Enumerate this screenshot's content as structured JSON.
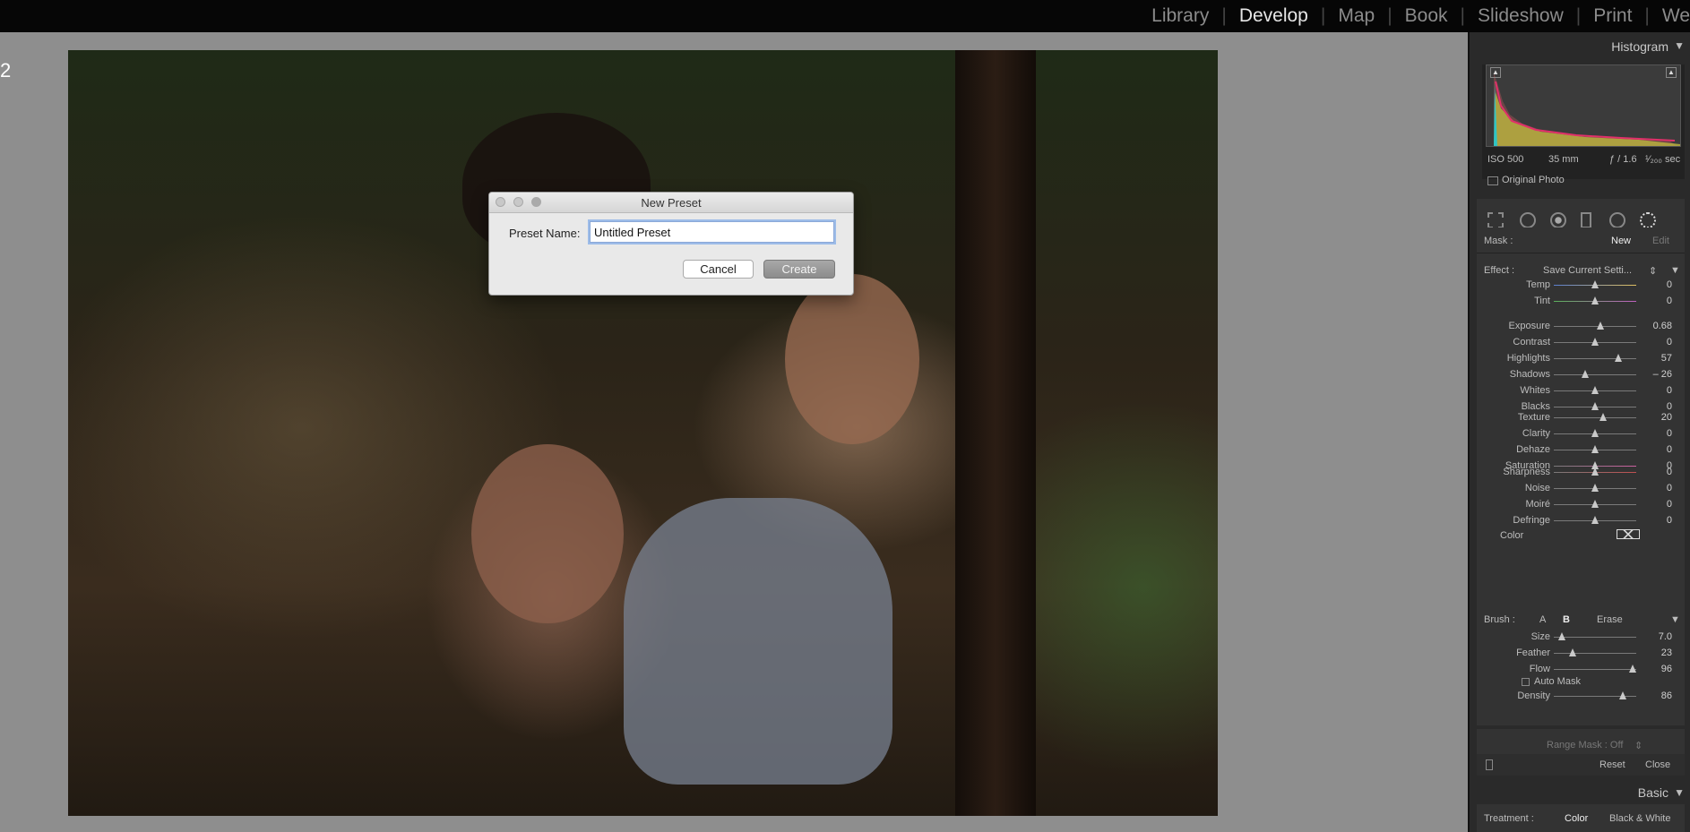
{
  "topbar": {
    "modules": [
      "Library",
      "Develop",
      "Map",
      "Book",
      "Slideshow",
      "Print",
      "We"
    ],
    "active": "Develop"
  },
  "left_fragment": "2",
  "histogram": {
    "title": "Histogram",
    "iso": "ISO 500",
    "focal": "35 mm",
    "aperture": "ƒ / 1.6",
    "shutter": "¹⁄₂₀₀ sec",
    "original_photo": "Original Photo"
  },
  "mask": {
    "label": "Mask :",
    "new": "New",
    "edit": "Edit"
  },
  "effect": {
    "label": "Effect :",
    "value": "Save Current Setti..."
  },
  "sliders_group1": [
    {
      "name": "Temp",
      "value": "0",
      "pos": 0.5
    },
    {
      "name": "Tint",
      "value": "0",
      "pos": 0.5
    }
  ],
  "sliders_group2": [
    {
      "name": "Exposure",
      "value": "0.68",
      "pos": 0.57
    },
    {
      "name": "Contrast",
      "value": "0",
      "pos": 0.5
    },
    {
      "name": "Highlights",
      "value": "57",
      "pos": 0.78
    },
    {
      "name": "Shadows",
      "value": "– 26",
      "pos": 0.38
    },
    {
      "name": "Whites",
      "value": "0",
      "pos": 0.5
    },
    {
      "name": "Blacks",
      "value": "0",
      "pos": 0.5
    }
  ],
  "sliders_group3": [
    {
      "name": "Texture",
      "value": "20",
      "pos": 0.6
    },
    {
      "name": "Clarity",
      "value": "0",
      "pos": 0.5
    },
    {
      "name": "Dehaze",
      "value": "0",
      "pos": 0.5
    },
    {
      "name": "Saturation",
      "value": "0",
      "pos": 0.5
    }
  ],
  "sliders_group4": [
    {
      "name": "Sharpness",
      "value": "0",
      "pos": 0.5
    },
    {
      "name": "Noise",
      "value": "0",
      "pos": 0.5
    },
    {
      "name": "Moiré",
      "value": "0",
      "pos": 0.5
    },
    {
      "name": "Defringe",
      "value": "0",
      "pos": 0.5
    }
  ],
  "color_label": "Color",
  "brush": {
    "label": "Brush :",
    "a": "A",
    "b": "B",
    "erase": "Erase"
  },
  "brush_sliders": [
    {
      "name": "Size",
      "value": "7.0",
      "pos": 0.1
    },
    {
      "name": "Feather",
      "value": "23",
      "pos": 0.23
    },
    {
      "name": "Flow",
      "value": "96",
      "pos": 0.96
    }
  ],
  "auto_mask": "Auto Mask",
  "density_slider": {
    "name": "Density",
    "value": "86",
    "pos": 0.84
  },
  "range_mask": "Range Mask : Off",
  "footer": {
    "reset": "Reset",
    "close": "Close"
  },
  "basic": {
    "title": "Basic",
    "treatment": "Treatment :",
    "color": "Color",
    "bw": "Black & White"
  },
  "dialog": {
    "title": "New Preset",
    "label": "Preset Name:",
    "input_value": "Untitled Preset",
    "cancel": "Cancel",
    "create": "Create"
  }
}
